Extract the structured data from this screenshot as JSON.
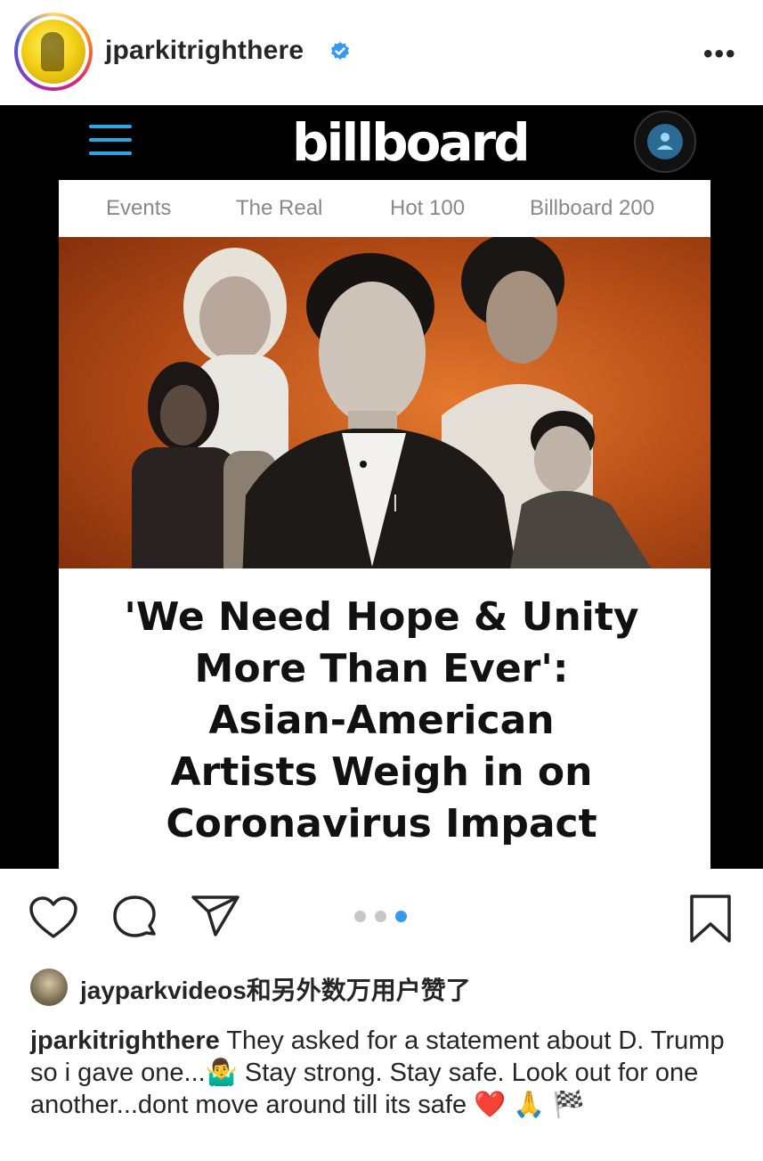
{
  "header": {
    "username": "jparkitrighthere",
    "more_label": "•••"
  },
  "post": {
    "site_logo": "billboard",
    "nav_items": [
      "Events",
      "The Real",
      "Hot 100",
      "Billboard 200"
    ],
    "headline_lines": [
      "'We Need Hope & Unity",
      "More Than Ever':",
      "Asian-American",
      "Artists Weigh in on",
      "Coronavirus Impact"
    ],
    "carousel": {
      "count": 3,
      "active_index": 2
    }
  },
  "actions": {
    "icons": [
      "heart-icon",
      "comment-icon",
      "share-icon",
      "bookmark-icon"
    ]
  },
  "likes": {
    "text": "jayparkvideos和另外数万用户赞了"
  },
  "caption": {
    "username": "jparkitrighthere",
    "text": " They asked for a statement about D. Trump so i gave one...🤷‍♂️ Stay strong. Stay safe. Look out for one another...dont move around till its safe ❤️ 🙏 🏁"
  },
  "colors": {
    "accent_blue": "#3897f0",
    "billboard_blue": "#2aa7e6",
    "hero_orange": "#c4571b"
  }
}
